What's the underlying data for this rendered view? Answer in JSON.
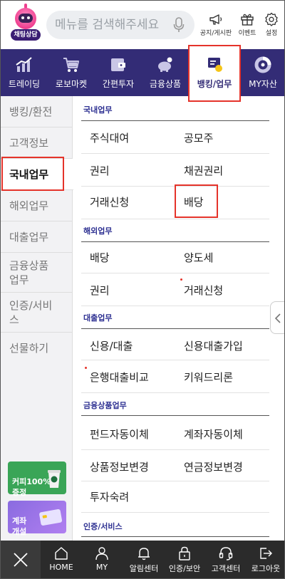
{
  "topbar": {
    "chatbot_label": "채팅상담",
    "search_placeholder": "메뉴를 검색해주세요",
    "icons": [
      {
        "name": "notice",
        "label": "공지/게시판"
      },
      {
        "name": "event",
        "label": "이벤트"
      },
      {
        "name": "settings",
        "label": "설정"
      }
    ]
  },
  "navbar": {
    "items": [
      {
        "label": "트레이딩",
        "icon": "chart-icon"
      },
      {
        "label": "로보마켓",
        "icon": "cart-icon"
      },
      {
        "label": "간편투자",
        "icon": "wallet-icon"
      },
      {
        "label": "금융상품",
        "icon": "piggy-icon"
      },
      {
        "label": "뱅킹/업무",
        "icon": "bank-icon",
        "active": true
      },
      {
        "label": "MY자산",
        "icon": "donut-icon"
      }
    ]
  },
  "sidebar": {
    "items": [
      {
        "label": "뱅킹/환전"
      },
      {
        "label": "고객정보"
      },
      {
        "label": "국내업무",
        "active": true
      },
      {
        "label": "해외업무"
      },
      {
        "label": "대출업무"
      },
      {
        "label": "금융상품\n업무"
      },
      {
        "label": "인증/서비\n스"
      },
      {
        "label": "선물하기"
      }
    ],
    "promos": [
      {
        "text": "커피100%\n증정",
        "color": "#3aa557"
      },
      {
        "text": "계좌\n개설",
        "color": "#8a6be0"
      }
    ]
  },
  "content": {
    "sections": [
      {
        "title": "국내업무",
        "rows": [
          [
            "주식대여",
            "공모주"
          ],
          [
            "권리",
            "채권권리"
          ],
          [
            "거래신청",
            "배당"
          ]
        ]
      },
      {
        "title": "해외업무",
        "rows": [
          [
            "배당",
            "양도세"
          ],
          [
            "권리",
            "거래신청"
          ]
        ]
      },
      {
        "title": "대출업무",
        "rows": [
          [
            "신용/대출",
            "신용대출가입"
          ],
          [
            "은행대출비교",
            "키워드리론"
          ]
        ]
      },
      {
        "title": "금융상품업무",
        "rows": [
          [
            "펀드자동이체",
            "계좌자동이체"
          ],
          [
            "상품정보변경",
            "연금정보변경"
          ],
          [
            "투자숙려",
            ""
          ]
        ]
      },
      {
        "title": "인증/서비스",
        "rows": []
      }
    ]
  },
  "bottombar": {
    "items": [
      {
        "label": "HOME"
      },
      {
        "label": "MY"
      },
      {
        "label": "알림센터"
      },
      {
        "label": "인증/보안"
      },
      {
        "label": "고객센터"
      },
      {
        "label": "로그아웃"
      }
    ]
  },
  "colors": {
    "nav_bg": "#332c76",
    "accent_red": "#e5332a",
    "section_title": "#2e3192",
    "bottom_bg": "#2b2b2b"
  }
}
